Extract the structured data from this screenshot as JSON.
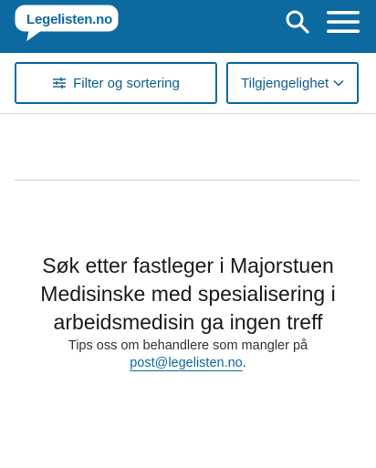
{
  "header": {
    "logo_text": "Legelisten.no",
    "brand_color": "#0d6aa0",
    "search_icon": "search-icon",
    "menu_icon": "hamburger-menu-icon"
  },
  "filters": {
    "filter_label": "Filter og sortering",
    "filter_icon": "sliders-icon",
    "availability_label": "Tilgjengelighet",
    "availability_icon": "chevron-down-icon"
  },
  "results": {
    "empty_title": "Søk etter fastleger i Majorstuen Medisinske med spesialisering i arbeidsmedisin ga ingen treff",
    "tips_prefix": "Tips oss om behandlere som mangler på",
    "tips_email": "post@legelisten.no",
    "tips_suffix": "."
  }
}
